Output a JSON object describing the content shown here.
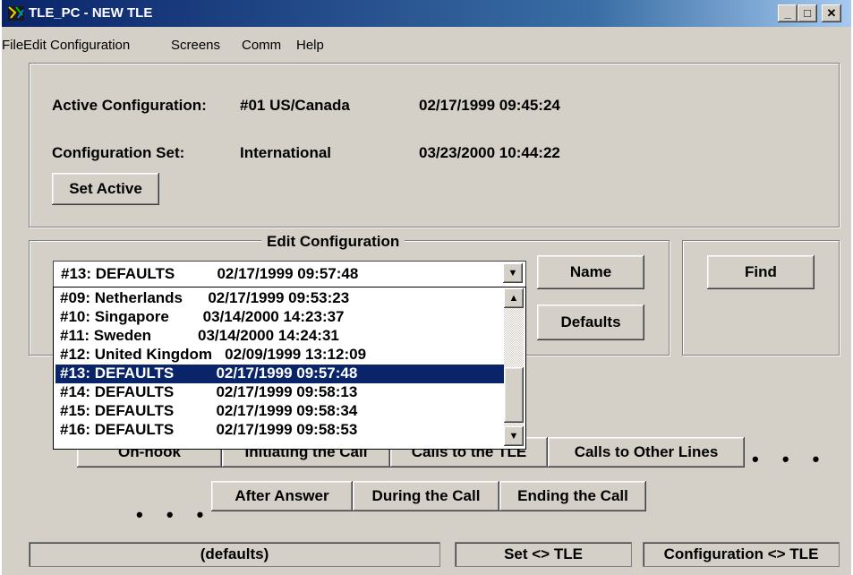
{
  "window": {
    "title": "TLE_PC - NEW TLE"
  },
  "caption_buttons": {
    "minimize": "_",
    "maximize": "□",
    "close": "✕"
  },
  "menu": [
    "File",
    "Edit Configuration",
    "Screens",
    "Comm",
    "Help"
  ],
  "active": {
    "label": "Active Configuration:",
    "value": "#01 US/Canada",
    "timestamp": "02/17/1999 09:45:24"
  },
  "config_set": {
    "label": "Configuration Set:",
    "value": "International",
    "timestamp": "03/23/2000 10:44:22"
  },
  "set_active_button": "Set Active",
  "edit_group": {
    "legend": "Edit Configuration",
    "combo_value": "#13: DEFAULTS          02/17/1999 09:57:48",
    "list": [
      "#09: Netherlands      02/17/1999 09:53:23",
      "#10: Singapore        03/14/2000 14:23:37",
      "#11: Sweden           03/14/2000 14:24:31",
      "#12: United Kingdom   02/09/1999 13:12:09",
      "#13: DEFAULTS          02/17/1999 09:57:48",
      "#14: DEFAULTS          02/17/1999 09:58:13",
      "#15: DEFAULTS          02/17/1999 09:58:34",
      "#16: DEFAULTS          02/17/1999 09:58:53"
    ],
    "selected_index": 4
  },
  "buttons": {
    "name": "Name",
    "defaults": "Defaults",
    "find": "Find"
  },
  "tabs_row1": [
    "On-hook",
    "Initiating the Call",
    "Calls to the TLE",
    "Calls to Other Lines"
  ],
  "tabs_row2": [
    "After Answer",
    "During the Call",
    "Ending the Call"
  ],
  "ellipsis": "• • •",
  "status": {
    "left": "(defaults)",
    "middle": "Set <> TLE",
    "right": "Configuration <> TLE"
  },
  "colors": {
    "title_bar": "#0a246a",
    "selection": "#0a246a",
    "face": "#d4d0c8"
  }
}
